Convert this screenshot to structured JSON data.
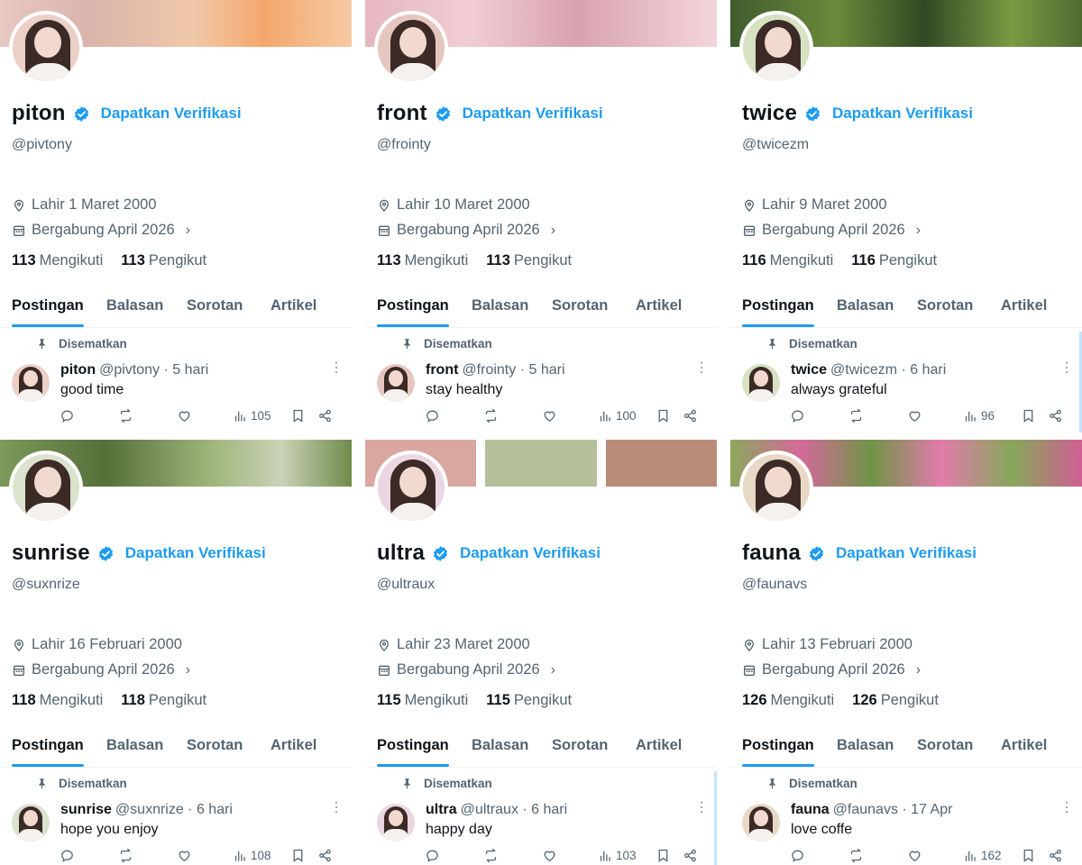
{
  "ui": {
    "get_verified": "Dapatkan Verifikasi",
    "pinned": "Disematkan",
    "following_word": "Mengikuti",
    "followers_word": "Pengikut",
    "tabs": [
      "Postingan",
      "Balasan",
      "Sorotan",
      "Artikel"
    ],
    "icons": {
      "location": "location-pin-icon",
      "calendar": "calendar-icon",
      "verified": "verified-badge-icon",
      "pin": "pin-icon",
      "reply": "reply-icon",
      "repost": "repost-icon",
      "like": "like-icon",
      "views": "views-icon",
      "bookmark": "bookmark-icon",
      "share": "share-icon",
      "more": "more-icon",
      "chevron": "chevron-right-icon"
    },
    "colors": {
      "accent": "#1d9bf0",
      "text": "#0f1419",
      "muted": "#536471"
    }
  },
  "profiles": [
    {
      "name": "piton",
      "handle": "@pivtony",
      "birth": "Lahir 1 Maret 2000",
      "joined": "Bergabung April 2026",
      "following": "113",
      "followers": "113",
      "post": {
        "name": "piton",
        "handle_time": "@pivtony · 5 hari",
        "text": "good time",
        "views": "105"
      }
    },
    {
      "name": "front",
      "handle": "@frointy",
      "birth": "Lahir 10 Maret 2000",
      "joined": "Bergabung April 2026",
      "following": "113",
      "followers": "113",
      "post": {
        "name": "front",
        "handle_time": "@frointy · 5 hari",
        "text": "stay healthy",
        "views": "100"
      }
    },
    {
      "name": "twice",
      "handle": "@twicezm",
      "birth": "Lahir 9 Maret 2000",
      "joined": "Bergabung April 2026",
      "following": "116",
      "followers": "116",
      "post": {
        "name": "twice",
        "handle_time": "@twicezm · 6 hari",
        "text": "always grateful",
        "views": "96"
      }
    },
    {
      "name": "sunrise",
      "handle": "@suxnrize",
      "birth": "Lahir 16 Februari 2000",
      "joined": "Bergabung April 2026",
      "following": "118",
      "followers": "118",
      "post": {
        "name": "sunrise",
        "handle_time": "@suxnrize · 6 hari",
        "text": "hope you enjoy",
        "views": "108"
      }
    },
    {
      "name": "ultra",
      "handle": "@ultraux",
      "birth": "Lahir 23 Maret 2000",
      "joined": "Bergabung April 2026",
      "following": "115",
      "followers": "115",
      "post": {
        "name": "ultra",
        "handle_time": "@ultraux · 6 hari",
        "text": "happy day",
        "views": "103"
      }
    },
    {
      "name": "fauna",
      "handle": "@faunavs",
      "birth": "Lahir 13 Februari 2000",
      "joined": "Bergabung April 2026",
      "following": "126",
      "followers": "126",
      "post": {
        "name": "fauna",
        "handle_time": "@faunavs · 17 Apr",
        "text": "love coffe",
        "views": "162"
      }
    }
  ]
}
